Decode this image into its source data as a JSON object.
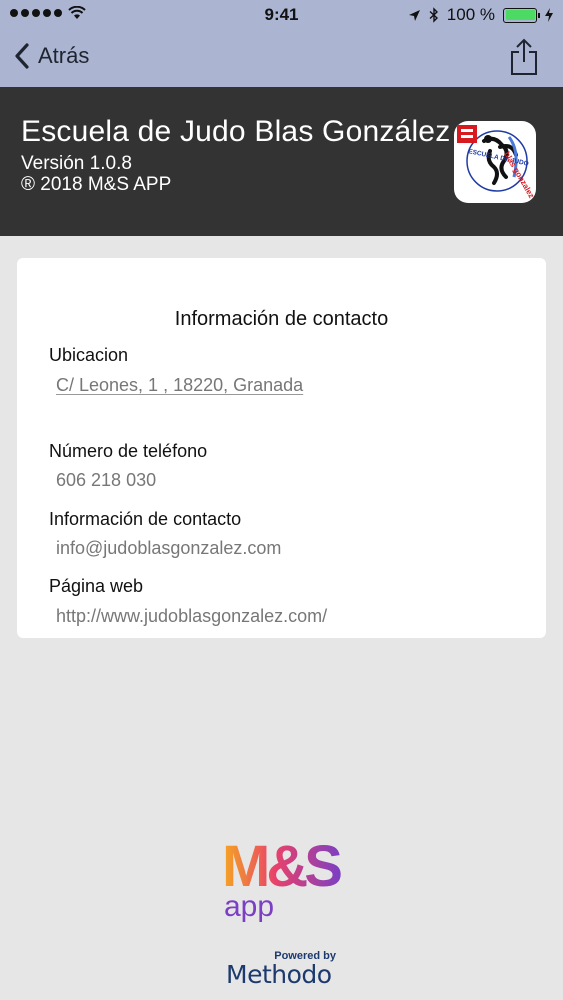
{
  "status_bar": {
    "time": "9:41",
    "battery": "100 %"
  },
  "nav": {
    "back_label": "Atrás"
  },
  "header": {
    "title": "Escuela de Judo Blas González",
    "version": "Versión 1.0.8",
    "copyright": "® 2018 M&S APP",
    "logo_top_text": "ESCUELA DE JUDO",
    "logo_side_text": "blas gonzalez"
  },
  "contact_card": {
    "title": "Información de contacto",
    "location_label": "Ubicacion",
    "location_value": "C/ Leones, 1 , 18220, Granada",
    "phone_label": "Número de teléfono",
    "phone_value": "606 218 030",
    "email_label": "Información de contacto",
    "email_value": "info@judoblasgonzalez.com",
    "web_label": "Página web",
    "web_value": "http://www.judoblasgonzalez.com/"
  },
  "footer": {
    "ms_logo_text": "M&S",
    "ms_app_text": "app",
    "powered_by": "Powered by",
    "brand": "Methodo"
  },
  "colors": {
    "topbar": "#abb5d2",
    "header": "#333333",
    "background": "#e6e6e6",
    "battery": "#4cd964",
    "brand_blue": "#1d3a6e"
  }
}
